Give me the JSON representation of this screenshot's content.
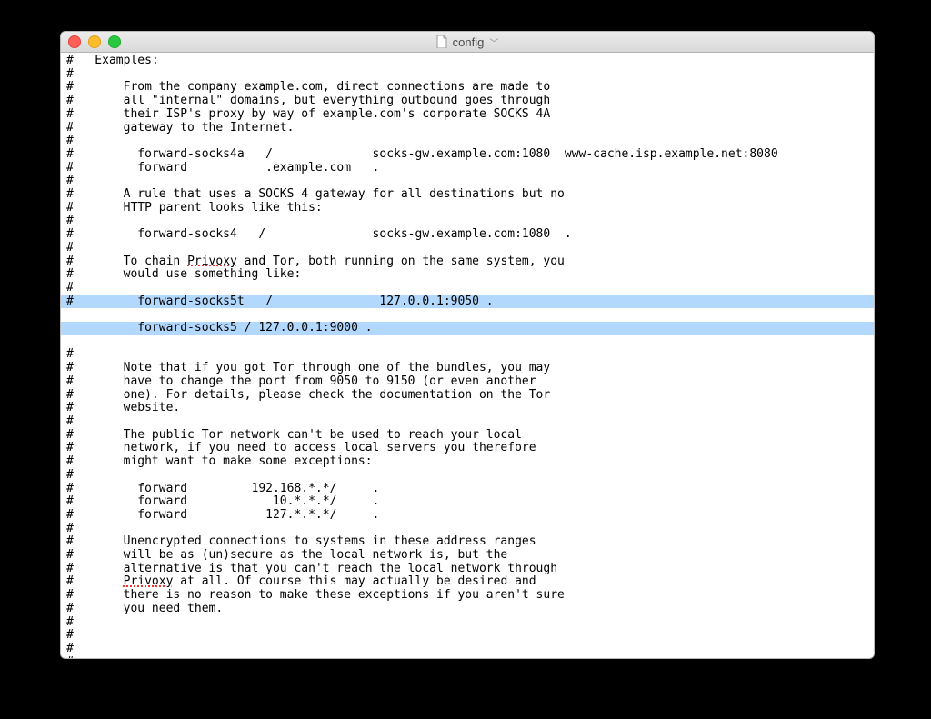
{
  "window": {
    "title": "config"
  },
  "lines": [
    "#   Examples:",
    "#",
    "#       From the company example.com, direct connections are made to",
    "#       all \"internal\" domains, but everything outbound goes through",
    "#       their ISP's proxy by way of example.com's corporate SOCKS 4A",
    "#       gateway to the Internet.",
    "#",
    "#         forward-socks4a   /              socks-gw.example.com:1080  www-cache.isp.example.net:8080",
    "#         forward           .example.com   .",
    "#",
    "#       A rule that uses a SOCKS 4 gateway for all destinations but no",
    "#       HTTP parent looks like this:",
    "#",
    "#         forward-socks4   /               socks-gw.example.com:1080  .",
    "#",
    "#       To chain Privoxy and Tor, both running on the same system, you",
    "#       would use something like:",
    "#"
  ],
  "selected": [
    "#         forward-socks5t   /               127.0.0.1:9050 .",
    "          forward-socks5 / 127.0.0.1:9000 ."
  ],
  "lines2": [
    "#",
    "#       Note that if you got Tor through one of the bundles, you may",
    "#       have to change the port from 9050 to 9150 (or even another",
    "#       one). For details, please check the documentation on the Tor",
    "#       website.",
    "#",
    "#       The public Tor network can't be used to reach your local",
    "#       network, if you need to access local servers you therefore",
    "#       might want to make some exceptions:",
    "#",
    "#         forward         192.168.*.*/     .",
    "#         forward            10.*.*.*/     .",
    "#         forward           127.*.*.*/     .",
    "#",
    "#       Unencrypted connections to systems in these address ranges",
    "#       will be as (un)secure as the local network is, but the",
    "#       alternative is that you can't reach the local network through",
    "#       Privoxy at all. Of course this may actually be desired and",
    "#       there is no reason to make these exceptions if you aren't sure",
    "#       you need them.",
    "#",
    "#",
    "#",
    "#",
    "#"
  ],
  "squiggles": [
    "Privoxy"
  ]
}
